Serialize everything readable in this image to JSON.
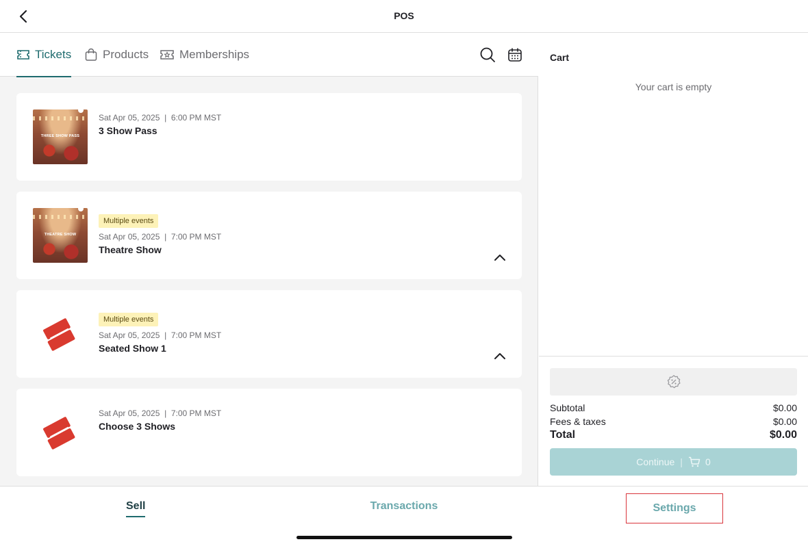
{
  "header": {
    "title": "POS"
  },
  "tabs": [
    {
      "label": "Tickets",
      "icon": "ticket-icon",
      "active": true
    },
    {
      "label": "Products",
      "icon": "bag-icon",
      "active": false
    },
    {
      "label": "Memberships",
      "icon": "membership-card-icon",
      "active": false
    }
  ],
  "tools": {
    "search_icon": "search-icon",
    "calendar_icon": "calendar-icon"
  },
  "events": [
    {
      "name": "3 Show Pass",
      "date": "Sat Apr 05, 2025",
      "time": "6:00 PM MST",
      "badge": "",
      "thumb_caption": "THREE SHOW PASS",
      "thumb_type": "photo",
      "expandable": false
    },
    {
      "name": "Theatre Show",
      "date": "Sat Apr 05, 2025",
      "time": "7:00 PM MST",
      "badge": "Multiple events",
      "thumb_caption": "THEATRE SHOW",
      "thumb_type": "photo",
      "expandable": true
    },
    {
      "name": "Seated Show 1",
      "date": "Sat Apr 05, 2025",
      "time": "7:00 PM MST",
      "badge": "Multiple events",
      "thumb_caption": "",
      "thumb_type": "ticket",
      "expandable": true
    },
    {
      "name": "Choose 3 Shows",
      "date": "Sat Apr 05, 2025",
      "time": "7:00 PM MST",
      "badge": "",
      "thumb_caption": "",
      "thumb_type": "ticket",
      "expandable": false
    }
  ],
  "cart": {
    "title": "Cart",
    "empty_text": "Your cart is empty",
    "subtotal_label": "Subtotal",
    "subtotal_value": "$0.00",
    "fees_label": "Fees & taxes",
    "fees_value": "$0.00",
    "total_label": "Total",
    "total_value": "$0.00",
    "continue_label": "Continue",
    "cart_count": "0"
  },
  "bottom_nav": {
    "sell": "Sell",
    "transactions": "Transactions",
    "settings": "Settings"
  },
  "colors": {
    "accent": "#1e6b6e",
    "badge_bg": "#fdf2b8",
    "continue_bg": "#a9d3d5",
    "highlight": "#d9343b"
  }
}
